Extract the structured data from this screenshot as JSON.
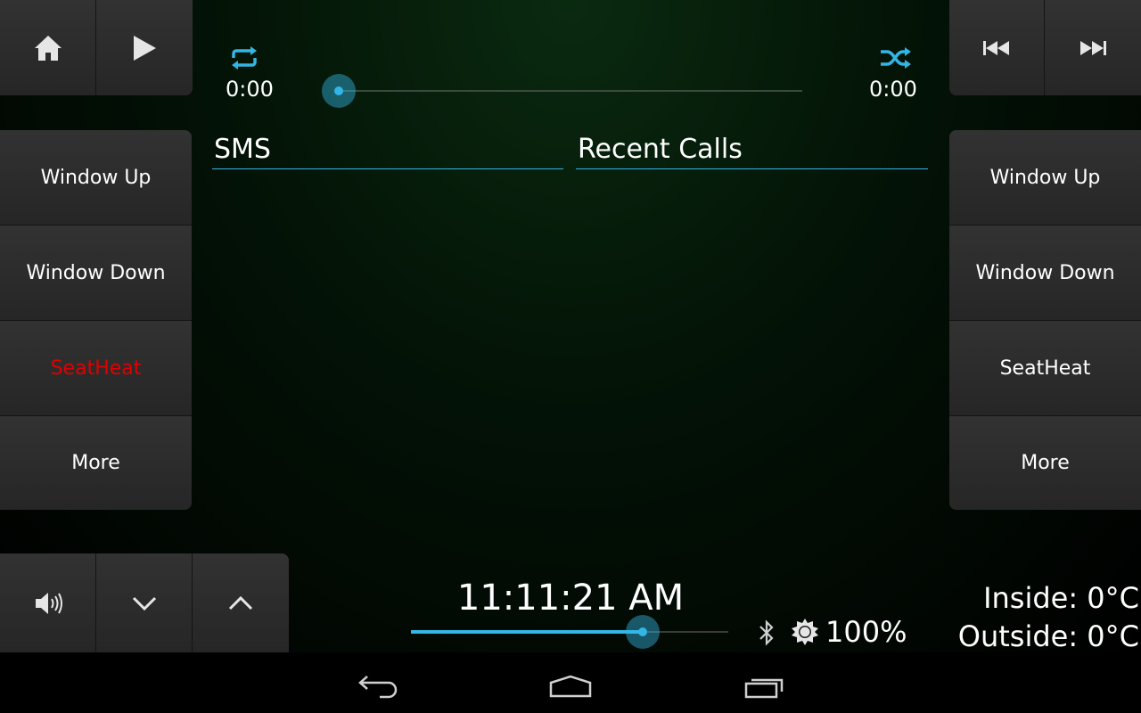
{
  "top_left": {
    "home_icon": "home-icon",
    "play_icon": "play-icon"
  },
  "top_right": {
    "previous_icon": "skip-previous-icon",
    "next_icon": "skip-next-icon"
  },
  "player": {
    "elapsed": "0:00",
    "duration": "0:00",
    "progress": 0,
    "repeat_icon": "repeat-icon",
    "shuffle_icon": "shuffle-icon"
  },
  "tabs": {
    "sms": "SMS",
    "recent_calls": "Recent Calls"
  },
  "left_panel": {
    "items": [
      {
        "label": "Window Up"
      },
      {
        "label": "Window Down"
      },
      {
        "label": "SeatHeat",
        "active_color": "#e00000"
      },
      {
        "label": "More"
      }
    ]
  },
  "right_panel": {
    "items": [
      {
        "label": "Window Up"
      },
      {
        "label": "Window Down"
      },
      {
        "label": "SeatHeat"
      },
      {
        "label": "More"
      }
    ]
  },
  "bottom_left": {
    "volume_icon": "volume-icon",
    "down_icon": "chevron-down-icon",
    "up_icon": "chevron-up-icon"
  },
  "status": {
    "clock": "11:11:21 AM",
    "volume_level": 0.73,
    "bluetooth_icon": "bluetooth-icon",
    "brightness_icon": "brightness-icon",
    "brightness": "100%",
    "inside_temp": "Inside: 0°C",
    "outside_temp": "Outside: 0°C"
  },
  "navbar": {
    "back_icon": "back-icon",
    "home_icon": "nav-home-icon",
    "recents_icon": "recent-apps-icon"
  },
  "colors": {
    "accent": "#33b5e5",
    "seatheat_active": "#e00000"
  }
}
